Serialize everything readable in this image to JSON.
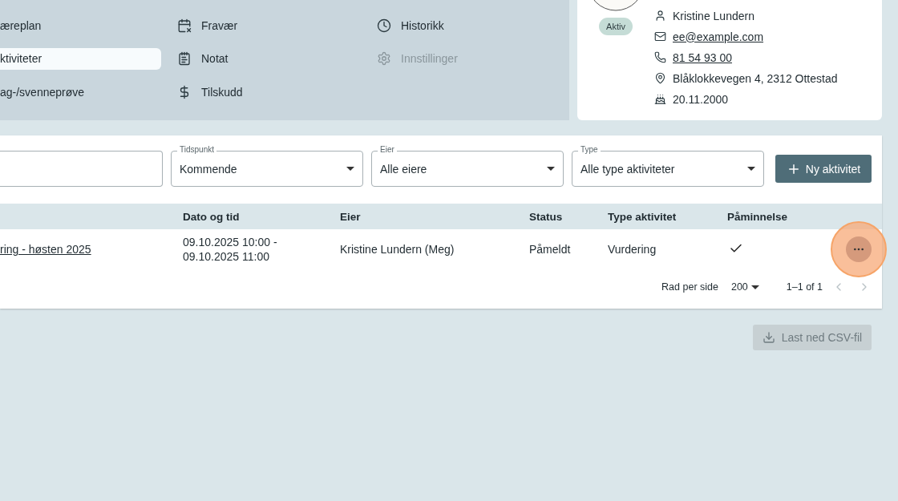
{
  "nav": {
    "columns": [
      [
        {
          "label": "æreplan",
          "selected": false,
          "disabled": false
        },
        {
          "label": "ktiviteter",
          "selected": true,
          "disabled": false
        },
        {
          "label": "ag-/svenneprøve",
          "selected": false,
          "disabled": false
        }
      ],
      [
        {
          "label": "Fravær",
          "selected": false,
          "disabled": false
        },
        {
          "label": "Notat",
          "selected": false,
          "disabled": false
        },
        {
          "label": "Tilskudd",
          "selected": false,
          "disabled": false
        }
      ],
      [
        {
          "label": "Historikk",
          "selected": false,
          "disabled": false
        },
        {
          "label": "Innstillinger",
          "selected": false,
          "disabled": true
        }
      ]
    ]
  },
  "profile": {
    "status": "Aktiv",
    "details": [
      {
        "kind": "text",
        "text": "Kristine Lundern"
      },
      {
        "kind": "link",
        "text": "ee@example.com"
      },
      {
        "kind": "link",
        "text": "81 54 93 00"
      },
      {
        "kind": "text",
        "text": "Blåklokkevegen 4, 2312 Ottestad"
      },
      {
        "kind": "text",
        "text": "20.11.2000"
      }
    ]
  },
  "filters": [
    {
      "kind": "search"
    },
    {
      "kind": "select",
      "label": "Tidspunkt",
      "value": "Kommende"
    },
    {
      "kind": "select",
      "label": "Eier",
      "value": "Alle eiere"
    },
    {
      "kind": "select",
      "label": "Type",
      "value": "Alle type aktiviteter"
    }
  ],
  "new_button": {
    "label": "Ny aktivitet"
  },
  "table": {
    "columns": [
      "",
      "Dato og tid",
      "Eier",
      "Status",
      "Type aktivitet",
      "Påminnelse"
    ],
    "rows": [
      {
        "title": "ring - høsten 2025",
        "time": "09.10.2025 10:00 - 09.10.2025 11:00",
        "owner": "Kristine Lundern (Meg)",
        "status": "Påmeldt",
        "type": "Vurdering",
        "reminder": true,
        "highlighted": true
      }
    ]
  },
  "pagination": {
    "rows_label": "Rad per side",
    "rows_value": "200",
    "range": "1–1 of 1",
    "prev_disabled": true,
    "next_disabled": true
  },
  "csv_button": {
    "label": "Last ned CSV-fil",
    "disabled": true
  }
}
